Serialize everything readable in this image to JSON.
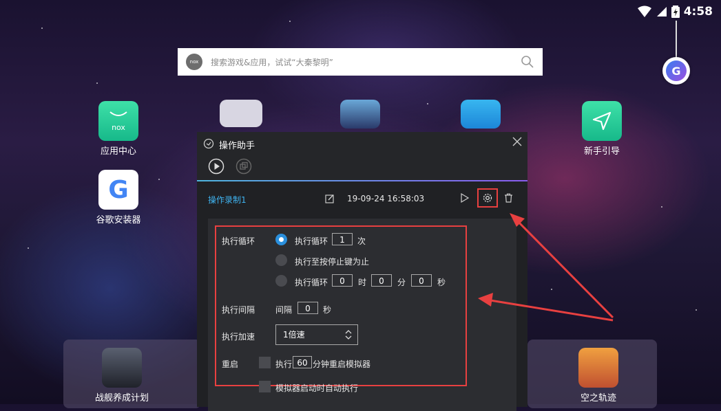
{
  "status_bar": {
    "time": "4:58"
  },
  "search": {
    "logo_text": "nox",
    "placeholder": "搜索游戏&应用，试试“大秦黎明”"
  },
  "apps": {
    "app_center": "应用中心",
    "google_installer": "谷歌安装器",
    "newbie_guide": "新手引导",
    "dock_left": "战舰养成计划",
    "dock_right": "空之轨迹"
  },
  "dialog": {
    "title": "操作助手",
    "record_name": "操作录制1",
    "record_time": "19-09-24 16:58:03",
    "settings": {
      "loop_label": "执行循环",
      "opt1_label": "执行循环",
      "opt1_count": "1",
      "opt1_unit": "次",
      "opt2_label": "执行至按停止键为止",
      "opt3_label": "执行循环",
      "opt3_h": "0",
      "opt3_h_unit": "时",
      "opt3_m": "0",
      "opt3_m_unit": "分",
      "opt3_s": "0",
      "opt3_s_unit": "秒",
      "interval_label": "执行间隔",
      "interval_prefix": "间隔",
      "interval_value": "0",
      "interval_unit": "秒",
      "speed_label": "执行加速",
      "speed_value": "1倍速",
      "restart_label": "重启",
      "restart_prefix": "执行",
      "restart_minutes": "60",
      "restart_suffix": "分钟重启模拟器",
      "autorun_label": "模拟器启动时自动执行"
    }
  },
  "colors": {
    "accent_blue": "#3fb3f0",
    "highlight_red": "#e84040",
    "radio_on": "#2a8fdc"
  }
}
